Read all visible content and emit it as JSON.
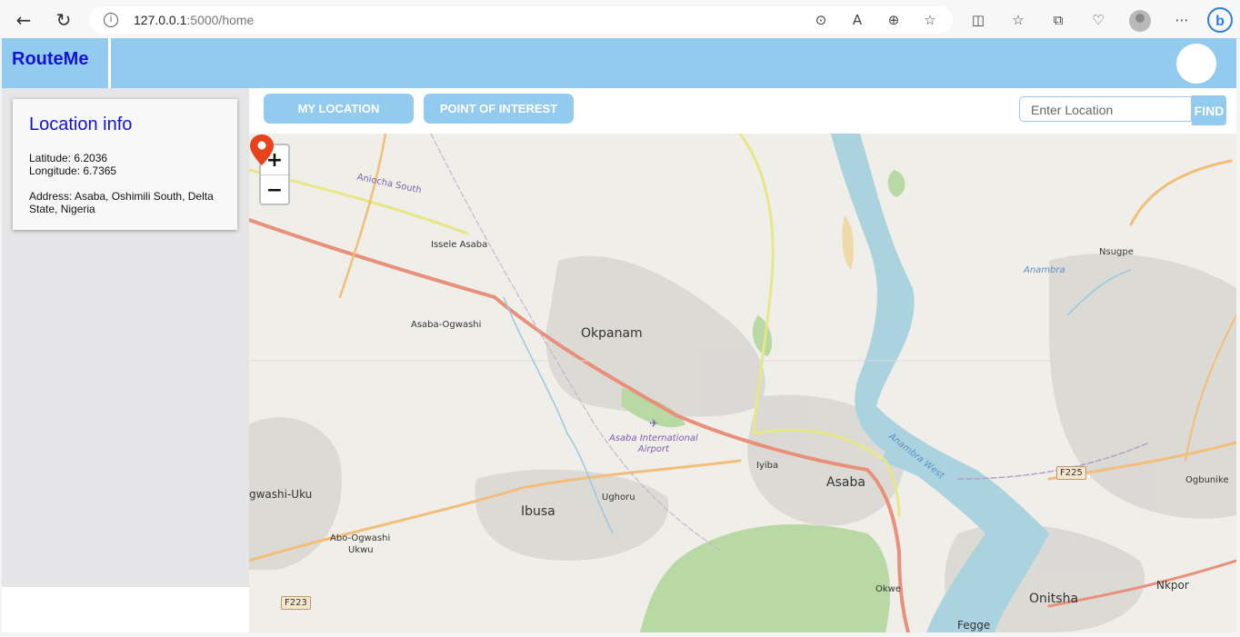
{
  "browser": {
    "url_host": "127.0.0.1",
    "url_path": ":5000/home",
    "icons": [
      "back-arrow-icon",
      "refresh-icon",
      "info-icon",
      "location-icon",
      "read-aloud-icon",
      "zoom-icon",
      "favorite-star-icon",
      "split-screen-icon",
      "favorites-icon",
      "collections-icon",
      "browser-essentials-icon",
      "profile-icon",
      "more-icon",
      "bing-icon"
    ]
  },
  "header": {
    "brand": "RouteMe",
    "accent_color": "#93cbee",
    "brand_color": "#1313d6"
  },
  "sidebar": {
    "card_title": "Location info",
    "latitude": "Latitude: 6.2036",
    "longitude": "Longitude: 6.7365",
    "address": "Address: Asaba, Oshimili South, Delta State, Nigeria"
  },
  "toolbar": {
    "my_location": "MY LOCATION",
    "poi": "POINT OF INTEREST",
    "search_placeholder": "Enter Location",
    "find": "FIND"
  },
  "map": {
    "zoom_in": "+",
    "zoom_out": "−",
    "labels": {
      "aniocha_south": "Aniocha South",
      "issele_asaba": "Issele Asaba",
      "asaba_ogwashi": "Asaba-Ogwashi",
      "okpanam": "Okpanam",
      "airport_line1": "Asaba International",
      "airport_line2": "Airport",
      "iyiba": "Iyiba",
      "asaba": "Asaba",
      "ughoru": "Ughoru",
      "ibusa": "Ibusa",
      "ogwashi_uku": "gwashi-Uku",
      "abo_ogwashi": "Abo-Ogwashi",
      "ukwu": "Ukwu",
      "f223": "F223",
      "okwe": "Okwe",
      "onitsha": "Onitsha",
      "fegge": "Fegge",
      "nkpor": "Nkpor",
      "ogbunike": "Ogbunike",
      "f225": "F225",
      "nsugpe": "Nsugpe",
      "anambra": "Anambra",
      "anambra_west": "Anambra West"
    },
    "marker_color": "#e8431c"
  }
}
